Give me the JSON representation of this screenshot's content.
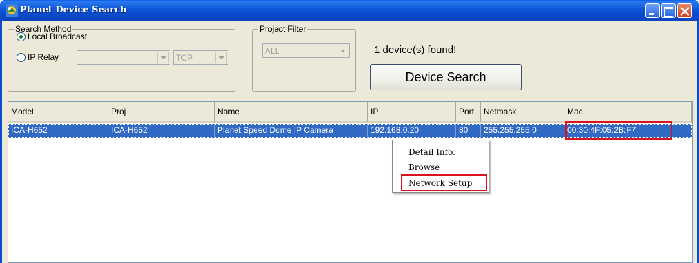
{
  "window": {
    "title": "Planet Device Search"
  },
  "search_method": {
    "legend": "Search Method",
    "local_broadcast_label": "Local Broadcast",
    "ip_relay_label": "IP Relay",
    "ip_relay_value": "",
    "protocol_value": "TCP"
  },
  "project_filter": {
    "legend": "Project Filter",
    "value": "ALL"
  },
  "status": {
    "text": "1 device(s) found!"
  },
  "device_search_button": {
    "label": "Device Search"
  },
  "table": {
    "columns": [
      "Model",
      "Proj",
      "Name",
      "IP",
      "Port",
      "Netmask",
      "Mac"
    ],
    "rows": [
      [
        "ICA-H652",
        "ICA-H652",
        "Planet Speed Dome IP Camera",
        "192.168.0.20",
        "80",
        "255.255.255.0",
        "00:30:4F:05:2B:F7"
      ]
    ]
  },
  "context_menu": {
    "items": [
      "Detail Info.",
      "Browse",
      "Network Setup"
    ]
  },
  "colors": {
    "selection": "#316ac5",
    "highlight_box": "#d8121f",
    "titlebar": "#0a4ccc"
  }
}
